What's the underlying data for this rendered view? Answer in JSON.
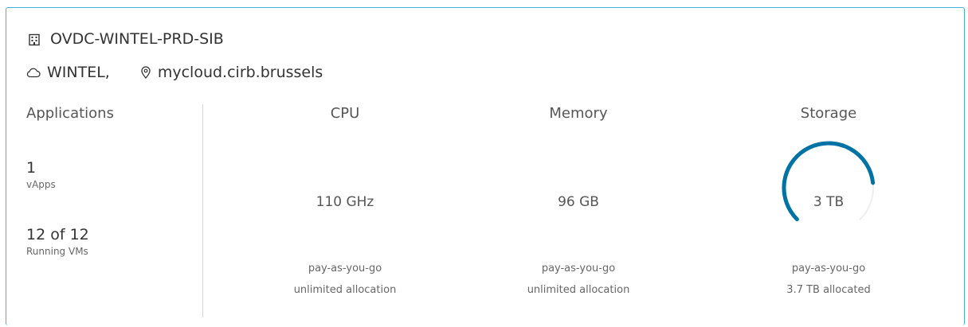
{
  "vdc": {
    "name": "OVDC-WINTEL-PRD-SIB",
    "org": "WINTEL,",
    "site": "mycloud.cirb.brussels"
  },
  "applications": {
    "header": "Applications",
    "vapps_value": "1",
    "vapps_label": "vApps",
    "vms_value": "12 of 12",
    "vms_label": "Running VMs"
  },
  "cpu": {
    "header": "CPU",
    "value": "110 GHz",
    "allocation_model": "pay-as-you-go",
    "allocation": "unlimited allocation"
  },
  "memory": {
    "header": "Memory",
    "value": "96 GB",
    "allocation_model": "pay-as-you-go",
    "allocation": "unlimited allocation"
  },
  "storage": {
    "header": "Storage",
    "value": "3 TB",
    "allocation_model": "pay-as-you-go",
    "allocation": "3.7 TB allocated",
    "usage_fraction": 0.81
  },
  "colors": {
    "accent": "#0072a3",
    "gauge_track": "#eeeeee",
    "card_border": "#49afd9"
  },
  "icons": {
    "vdc": "building-icon",
    "org": "cloud-icon",
    "site": "location-pin-icon"
  }
}
